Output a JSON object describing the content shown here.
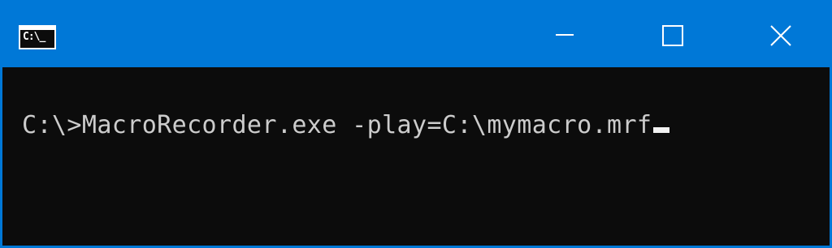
{
  "window": {
    "icon": "cmd-icon",
    "icon_text": "C:\\_",
    "controls": {
      "minimize": "minimize-icon",
      "maximize": "maximize-icon",
      "close": "close-icon"
    }
  },
  "console": {
    "prompt": "C:\\>",
    "command": "MacroRecorder.exe -play=C:\\mymacro.mrf"
  },
  "colors": {
    "titlebar": "#0078d7",
    "console_bg": "#0c0c0c",
    "console_text": "#cccccc"
  }
}
